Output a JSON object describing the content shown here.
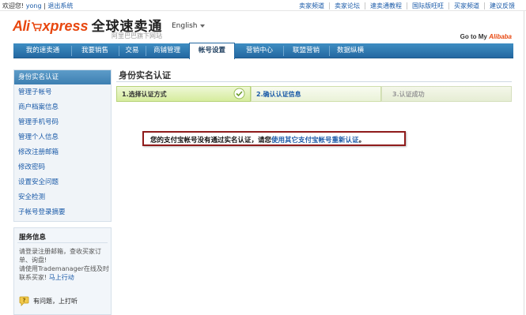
{
  "topbar": {
    "greeting": "欢迎您!",
    "username": "yong",
    "logout": "退出系统",
    "links": [
      "卖家频道",
      "卖家论坛",
      "速卖通教程",
      "国际版旺旺",
      "买家频道",
      "建议反馈"
    ]
  },
  "header": {
    "logo_prefix": "Ali",
    "logo_suffix": "xpress",
    "logo_cn": "全球速卖通",
    "logo_sub": "阿里巴巴旗下网站",
    "language": "English",
    "goto_prefix": "Go to My",
    "goto_brand": "Alibaba"
  },
  "nav": {
    "tabs": [
      "我的速卖通",
      "我要销售",
      "交易",
      "商铺管理",
      "帐号设置",
      "营销中心",
      "联盟营销",
      "数据纵横"
    ],
    "active_index": 4
  },
  "sidebar": {
    "items": [
      "身份实名认证",
      "管理子帐号",
      "商户档案信息",
      "管理手机号码",
      "管理个人信息",
      "修改注册邮箱",
      "修改密码",
      "设置安全问题",
      "安全检测",
      "子帐号登录摘要"
    ],
    "active_index": 0
  },
  "service": {
    "title": "服务信息",
    "line1": "请登录注册邮箱，查收买家订单、询盘!",
    "line2_prefix": "请使用Trademanager在线及时联系买家!",
    "line2_link": "马上行动",
    "help": "有问题，上打听"
  },
  "main": {
    "title": "身份实名认证",
    "steps": [
      "1.选择认证方式",
      "2.确认认证信息",
      "3.认证成功"
    ],
    "notice_text": "您的支付宝帐号没有通过实名认证，请您",
    "notice_link": "使用其它支付宝帐号重新认证",
    "notice_end": "。"
  },
  "colors": {
    "brand_orange": "#e8470f",
    "nav_blue": "#2468a1",
    "link_blue": "#1a5aa8",
    "notice_border": "#8f1b1b",
    "step_green": "#d6ec9d"
  }
}
